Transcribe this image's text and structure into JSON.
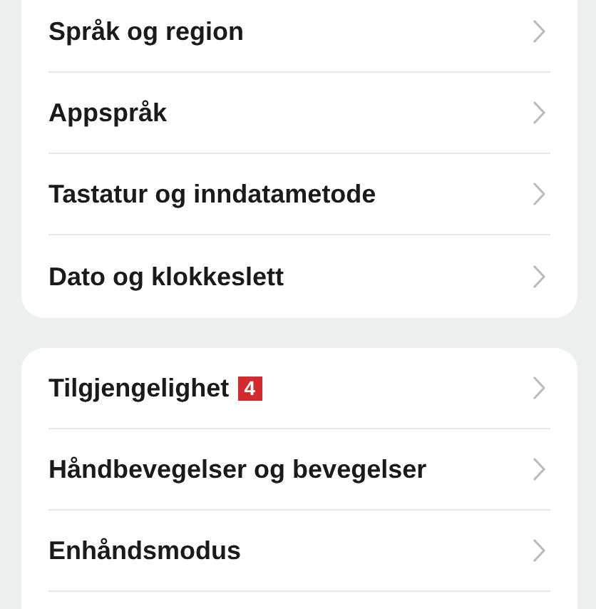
{
  "sections": [
    {
      "items": [
        {
          "label": "Språk og region"
        },
        {
          "label": "Appspråk"
        },
        {
          "label": "Tastatur og inndatametode"
        },
        {
          "label": "Dato og klokkeslett"
        }
      ]
    },
    {
      "items": [
        {
          "label": "Tilgjengelighet",
          "badge": "4"
        },
        {
          "label": "Håndbevegelser og bevegelser"
        },
        {
          "label": "Enhåndsmodus"
        }
      ],
      "continues": true
    }
  ]
}
